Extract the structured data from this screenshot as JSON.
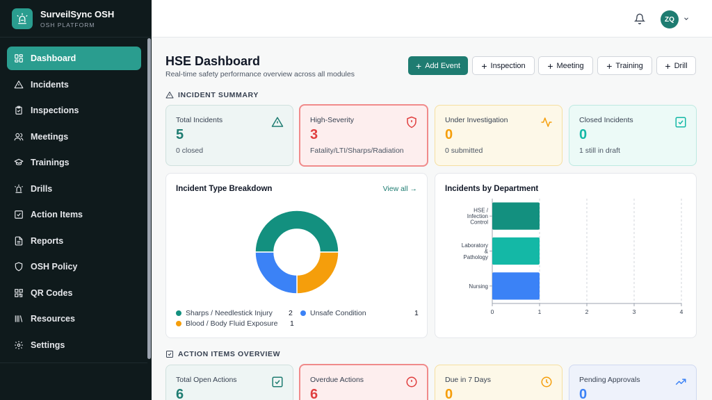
{
  "brand": {
    "title": "SurveilSync OSH",
    "subtitle": "OSH PLATFORM"
  },
  "sidebar": {
    "items": [
      {
        "label": "Dashboard",
        "icon": "grid-icon",
        "active": true
      },
      {
        "label": "Incidents",
        "icon": "warning-icon"
      },
      {
        "label": "Inspections",
        "icon": "clipboard-icon"
      },
      {
        "label": "Meetings",
        "icon": "users-icon"
      },
      {
        "label": "Trainings",
        "icon": "graduation-cap-icon"
      },
      {
        "label": "Drills",
        "icon": "siren-icon"
      },
      {
        "label": "Action Items",
        "icon": "checkbox-icon"
      },
      {
        "label": "Reports",
        "icon": "document-icon"
      },
      {
        "label": "OSH Policy",
        "icon": "shield-icon"
      },
      {
        "label": "QR Codes",
        "icon": "qr-code-icon"
      },
      {
        "label": "Resources",
        "icon": "library-icon"
      },
      {
        "label": "Settings",
        "icon": "gear-icon"
      }
    ]
  },
  "header": {
    "avatar_initials": "ZQ"
  },
  "page": {
    "title": "HSE Dashboard",
    "subtitle": "Real-time safety performance overview across all modules"
  },
  "toolbar": {
    "add_event": "Add Event",
    "inspection": "Inspection",
    "meeting": "Meeting",
    "training": "Training",
    "drill": "Drill"
  },
  "incident_summary": {
    "title": "INCIDENT SUMMARY",
    "cards": [
      {
        "label": "Total Incidents",
        "value": "5",
        "sub": "0 closed",
        "color": "#1e7c71"
      },
      {
        "label": "High-Severity",
        "value": "3",
        "sub": "Fatality/LTI/Sharps/Radiation",
        "color": "#e03e3e"
      },
      {
        "label": "Under Investigation",
        "value": "0",
        "sub": "0 submitted",
        "color": "#f59e0b"
      },
      {
        "label": "Closed Incidents",
        "value": "0",
        "sub": "1 still in draft",
        "color": "#14b8a6"
      }
    ]
  },
  "type_breakdown": {
    "title": "Incident Type Breakdown",
    "view_all": "View all →",
    "legend": [
      {
        "label": "Sharps / Needlestick Injury",
        "count": "2",
        "color": "#13907f"
      },
      {
        "label": "Unsafe Condition",
        "count": "1",
        "color": "#3b82f6"
      },
      {
        "label": "Blood / Body Fluid Exposure",
        "count": "1",
        "color": "#f59e0b"
      }
    ]
  },
  "chart_data": [
    {
      "type": "pie",
      "categories": [
        "Sharps / Needlestick Injury",
        "Blood / Body Fluid Exposure",
        "Unsafe Condition"
      ],
      "values": [
        2,
        1,
        1
      ],
      "colors": [
        "#13907f",
        "#f59e0b",
        "#3b82f6"
      ],
      "donut": true
    },
    {
      "type": "bar",
      "orientation": "horizontal",
      "title": "Incidents by Department",
      "categories": [
        [
          "HSE /",
          "Infection",
          "Control"
        ],
        [
          "Laboratory",
          "&",
          "Pathology"
        ],
        [
          "Nursing"
        ]
      ],
      "values": [
        1,
        1,
        1
      ],
      "colors": [
        "#13907f",
        "#14b8a6",
        "#3b82f6"
      ],
      "xticks": [
        "0",
        "1",
        "2",
        "3",
        "4"
      ],
      "xlim": [
        0,
        4
      ],
      "grid": true
    }
  ],
  "action_items": {
    "title": "ACTION ITEMS OVERVIEW",
    "cards": [
      {
        "label": "Total Open Actions",
        "value": "6",
        "color": "#1e7c71"
      },
      {
        "label": "Overdue Actions",
        "value": "6",
        "color": "#e03e3e"
      },
      {
        "label": "Due in 7 Days",
        "value": "0",
        "color": "#f59e0b"
      },
      {
        "label": "Pending Approvals",
        "value": "0",
        "color": "#3b82f6"
      }
    ]
  }
}
